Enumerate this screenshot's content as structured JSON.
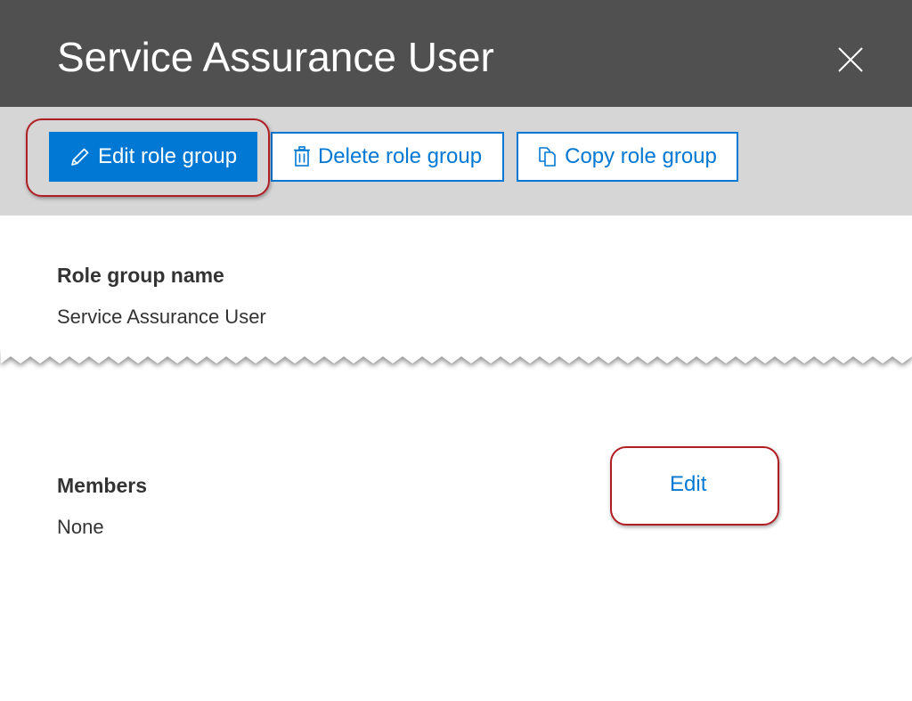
{
  "panel": {
    "title": "Service Assurance User"
  },
  "toolbar": {
    "edit_label": "Edit role group",
    "delete_label": "Delete role group",
    "copy_label": "Copy role group"
  },
  "details": {
    "role_group_name_label": "Role group name",
    "role_group_name_value": "Service Assurance User",
    "members_label": "Members",
    "members_value": "None",
    "members_edit_label": "Edit"
  },
  "colors": {
    "header_bg": "#505050",
    "toolbar_bg": "#d6d6d6",
    "accent": "#0078d4",
    "callout": "#b01e24"
  }
}
